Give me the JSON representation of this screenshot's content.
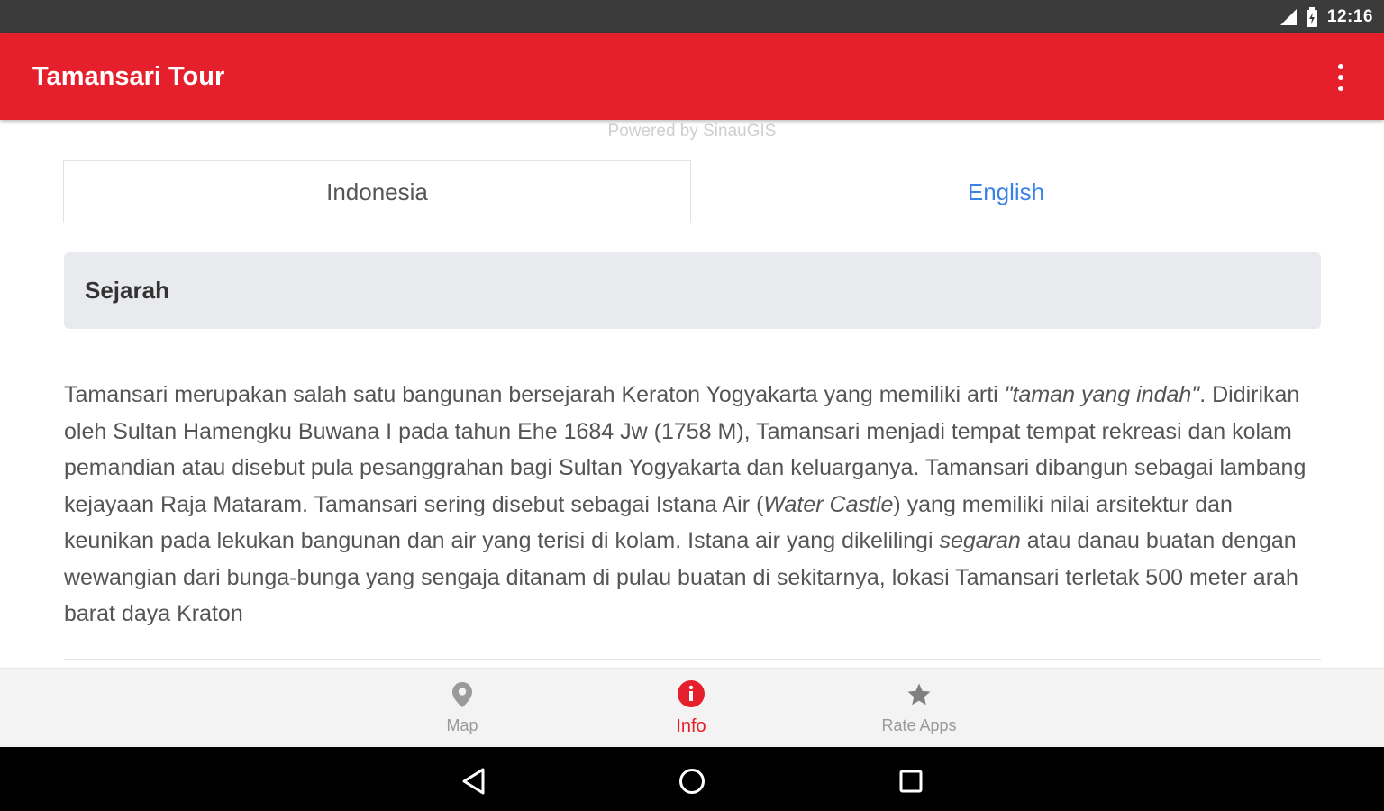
{
  "status_bar": {
    "time": "12:16",
    "icons": [
      "signal-icon",
      "battery-icon"
    ]
  },
  "app_bar": {
    "title": "Tamansari Tour",
    "menu_icon": "overflow-menu-icon"
  },
  "powered_by": "Powered by SinauGIS",
  "tabs": [
    {
      "label": "Indonesia",
      "selected": true
    },
    {
      "label": "English",
      "selected": false
    }
  ],
  "section": {
    "title": "Sejarah",
    "paragraph": [
      {
        "text": "Tamansari merupakan salah satu bangunan bersejarah Keraton Yogyakarta yang memiliki arti ",
        "italic": false
      },
      {
        "text": "\"taman yang indah\"",
        "italic": true
      },
      {
        "text": ". Didirikan oleh Sultan Hamengku Buwana I pada tahun Ehe 1684 Jw (1758 M), Tamansari menjadi tempat tempat rekreasi dan kolam pemandian atau disebut pula pesanggrahan bagi Sultan Yogyakarta dan keluarganya. Tamansari dibangun sebagai lambang kejayaan Raja Mataram. Tamansari sering disebut sebagai Istana Air (",
        "italic": false
      },
      {
        "text": "Water Castle",
        "italic": true
      },
      {
        "text": ") yang memiliki nilai arsitektur dan keunikan pada lekukan bangunan dan air yang terisi di kolam. Istana air yang dikelilingi ",
        "italic": false
      },
      {
        "text": "segaran",
        "italic": true
      },
      {
        "text": " atau danau buatan dengan wewangian dari bunga-bunga yang sengaja ditanam di pulau buatan di sekitarnya, lokasi Tamansari terletak 500 meter arah barat daya Kraton",
        "italic": false
      }
    ]
  },
  "bottom_nav": [
    {
      "label": "Map",
      "icon": "map-pin-icon",
      "active": false
    },
    {
      "label": "Info",
      "icon": "info-icon",
      "active": true
    },
    {
      "label": "Rate Apps",
      "icon": "star-icon",
      "active": false
    }
  ],
  "system_nav": [
    "back-icon",
    "home-icon",
    "recents-icon"
  ],
  "colors": {
    "primary": "#e5202c",
    "tab_inactive": "#3b82e6",
    "status_bar": "#3b3b3b"
  }
}
